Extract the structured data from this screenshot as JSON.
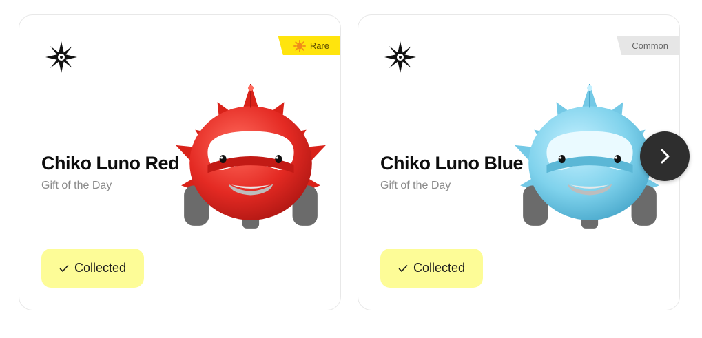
{
  "cards": [
    {
      "title": "Chiko Luno Red",
      "subtitle": "Gift of the Day",
      "badge_label": "Rare",
      "badge_color": "#ffe40d",
      "badge_icon": "sun-icon",
      "mascot_color": "#e42a23",
      "button_label": "Collected",
      "button_color": "#fdfc97"
    },
    {
      "title": "Chiko Luno Blue",
      "subtitle": "Gift of the Day",
      "badge_label": "Common",
      "badge_color": "#e6e6e6",
      "mascot_color": "#7fd2ec",
      "button_label": "Collected",
      "button_color": "#fdfc97"
    }
  ],
  "icons": {
    "logo": "star-compass-logo-icon",
    "check": "check-icon",
    "next": "chevron-right-icon"
  }
}
